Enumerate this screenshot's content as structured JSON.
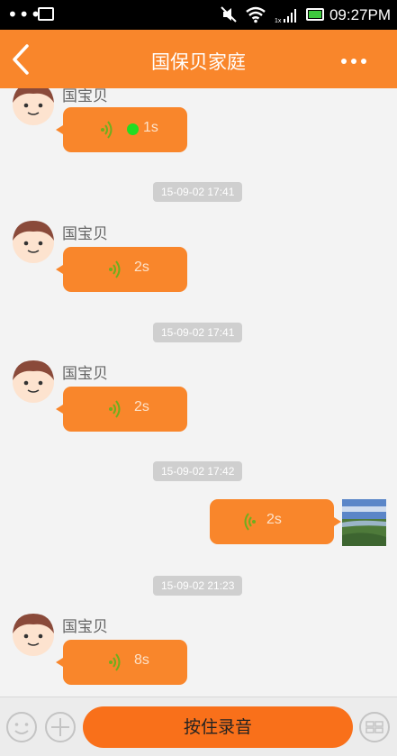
{
  "status_bar": {
    "dots": "•••",
    "time": "09:27PM",
    "network_label": "1x",
    "colors": {
      "battery": "#3ec93e"
    }
  },
  "header": {
    "title": "国保贝家庭",
    "background": "#f9862b"
  },
  "messages": [
    {
      "type": "voice",
      "side": "left",
      "sender": "国宝贝",
      "duration": "1s",
      "unread": true
    },
    {
      "type": "timestamp",
      "text": "15-09-02 17:41"
    },
    {
      "type": "voice",
      "side": "left",
      "sender": "国宝贝",
      "duration": "2s"
    },
    {
      "type": "timestamp",
      "text": "15-09-02 17:41"
    },
    {
      "type": "voice",
      "side": "left",
      "sender": "国宝贝",
      "duration": "2s"
    },
    {
      "type": "timestamp",
      "text": "15-09-02 17:42"
    },
    {
      "type": "voice",
      "side": "right",
      "duration": "2s"
    },
    {
      "type": "timestamp",
      "text": "15-09-02 21:23"
    },
    {
      "type": "voice",
      "side": "left",
      "sender": "国宝贝",
      "duration": "8s"
    }
  ],
  "input_bar": {
    "record_label": "按住录音",
    "icons": [
      "emoji-icon",
      "plus-icon",
      "keyboard-icon"
    ],
    "record_color": "#f9701a"
  }
}
